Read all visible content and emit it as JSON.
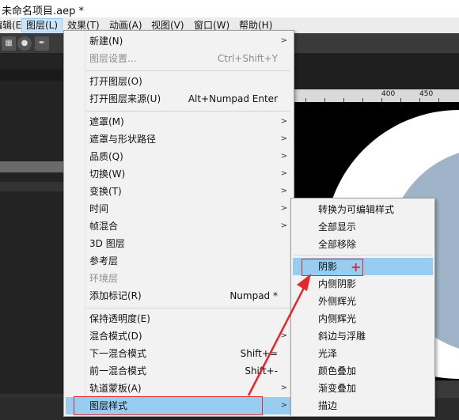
{
  "window": {
    "title": "未命名项目.aep *"
  },
  "menubar": [
    {
      "name": "menu-edit",
      "label": "编辑(E)"
    },
    {
      "name": "menu-layer",
      "label": "图层(L)",
      "active": true
    },
    {
      "name": "menu-effect",
      "label": "效果(T)"
    },
    {
      "name": "menu-animation",
      "label": "动画(A)"
    },
    {
      "name": "menu-view",
      "label": "视图(V)"
    },
    {
      "name": "menu-window",
      "label": "窗口(W)"
    },
    {
      "name": "menu-help",
      "label": "帮助(H)"
    }
  ],
  "ruler": {
    "labels": [
      "400",
      "450"
    ]
  },
  "layer_menu": {
    "items": [
      {
        "label": "新建(N)",
        "shortcut": "",
        "submenu": true,
        "disabled": false
      },
      {
        "label": "图层设置...",
        "shortcut": "Ctrl+Shift+Y",
        "submenu": false,
        "disabled": true
      },
      {
        "label": "打开图层(O)",
        "shortcut": "",
        "submenu": false,
        "disabled": false
      },
      {
        "label": "打开图层来源(U)",
        "shortcut": "Alt+Numpad Enter",
        "submenu": false,
        "disabled": false
      },
      {
        "label": "遮罩(M)",
        "shortcut": "",
        "submenu": true,
        "disabled": false
      },
      {
        "label": "遮罩与形状路径",
        "shortcut": "",
        "submenu": true,
        "disabled": false
      },
      {
        "label": "品质(Q)",
        "shortcut": "",
        "submenu": true,
        "disabled": false
      },
      {
        "label": "切换(W)",
        "shortcut": "",
        "submenu": true,
        "disabled": false
      },
      {
        "label": "变换(T)",
        "shortcut": "",
        "submenu": true,
        "disabled": false
      },
      {
        "label": "时间",
        "shortcut": "",
        "submenu": true,
        "disabled": false
      },
      {
        "label": "帧混合",
        "shortcut": "",
        "submenu": true,
        "disabled": false
      },
      {
        "label": "3D 图层",
        "shortcut": "",
        "submenu": false,
        "disabled": false
      },
      {
        "label": "参考层",
        "shortcut": "",
        "submenu": false,
        "disabled": false
      },
      {
        "label": "环境层",
        "shortcut": "",
        "submenu": false,
        "disabled": true
      },
      {
        "label": "添加标记(R)",
        "shortcut": "Numpad *",
        "submenu": false,
        "disabled": false
      },
      {
        "label": "保持透明度(E)",
        "shortcut": "",
        "submenu": false,
        "disabled": false
      },
      {
        "label": "混合模式(D)",
        "shortcut": "",
        "submenu": true,
        "disabled": false
      },
      {
        "label": "下一混合模式",
        "shortcut": "Shift+=",
        "submenu": false,
        "disabled": false
      },
      {
        "label": "前一混合模式",
        "shortcut": "Shift+-",
        "submenu": false,
        "disabled": false
      },
      {
        "label": "轨道蒙板(A)",
        "shortcut": "",
        "submenu": true,
        "disabled": false
      },
      {
        "label": "图层样式",
        "shortcut": "",
        "submenu": true,
        "disabled": false,
        "highlighted": true
      }
    ]
  },
  "layer_styles_submenu": {
    "items": [
      {
        "label": "转换为可编辑样式"
      },
      {
        "label": "全部显示"
      },
      {
        "label": "全部移除"
      },
      {
        "label": "阴影",
        "highlighted": true
      },
      {
        "label": "内侧阴影"
      },
      {
        "label": "外侧辉光"
      },
      {
        "label": "内侧辉光"
      },
      {
        "label": "斜边与浮雕"
      },
      {
        "label": "光泽"
      },
      {
        "label": "颜色叠加"
      },
      {
        "label": "渐变叠加"
      },
      {
        "label": "描边"
      }
    ]
  },
  "annotation": {
    "plus_glyph": "+",
    "color": "#e5262b"
  },
  "colors": {
    "highlight": "#99ccf1",
    "menu_bg": "#f2f2f2",
    "annotation": "#e5262b"
  }
}
